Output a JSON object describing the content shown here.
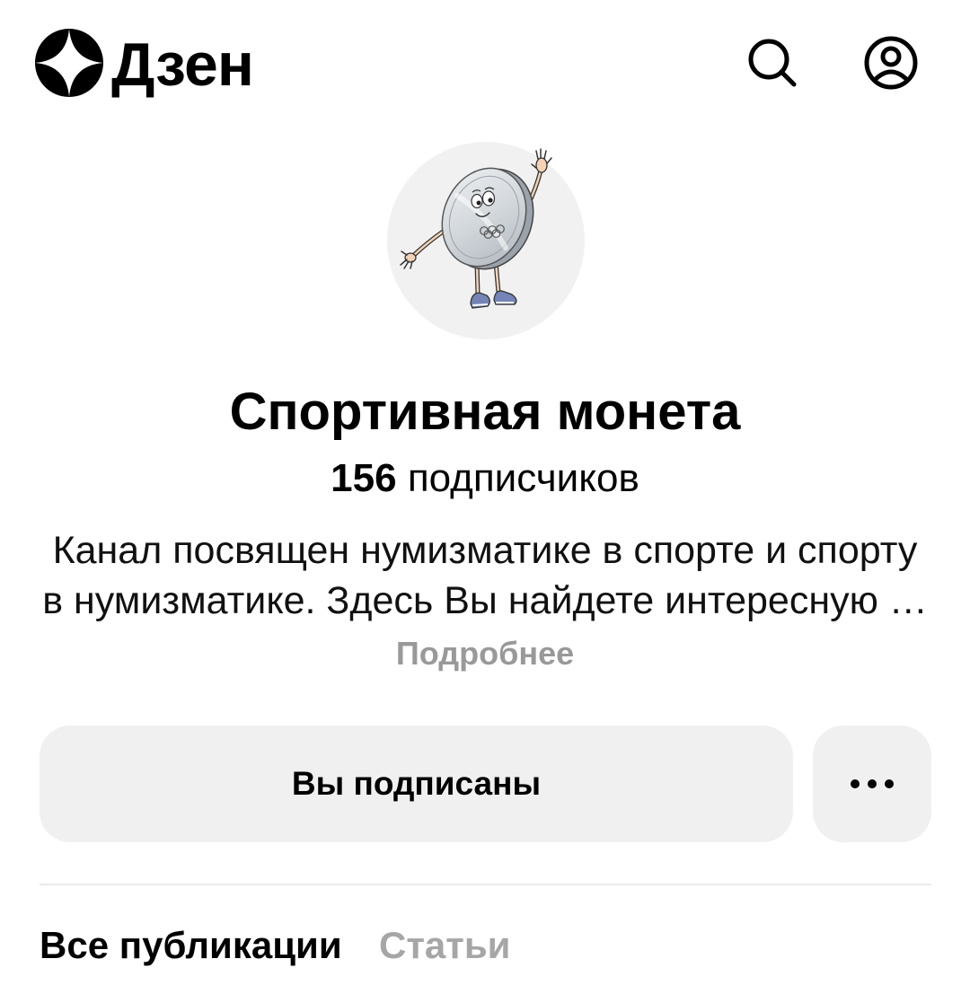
{
  "header": {
    "logo_text": "Дзен",
    "logo_icon": "dzen-logo-icon",
    "search_icon": "search-icon",
    "profile_icon": "profile-icon"
  },
  "channel": {
    "avatar": "coin-mascot-avatar",
    "name": "Спортивная монета",
    "subscribers_count": "156",
    "subscribers_label": "подписчиков",
    "description_lines": [
      "Канал посвящен нумизматике в спорте и спорту",
      "в нумизматике. Здесь Вы найдете интересную …"
    ],
    "more_link": "Подробнее"
  },
  "actions": {
    "subscribe_state_label": "Вы подписаны",
    "more_icon": "more-dots-icon"
  },
  "tabs": [
    {
      "label": "Все публикации",
      "active": true
    },
    {
      "label": "Статьи",
      "active": false
    }
  ],
  "colors": {
    "text": "#000000",
    "muted": "#999999",
    "inactive_tab": "#a6a6a6",
    "button_bg": "#f0f0f0",
    "avatar_bg": "#f1f1f1",
    "divider": "#ebebeb"
  }
}
